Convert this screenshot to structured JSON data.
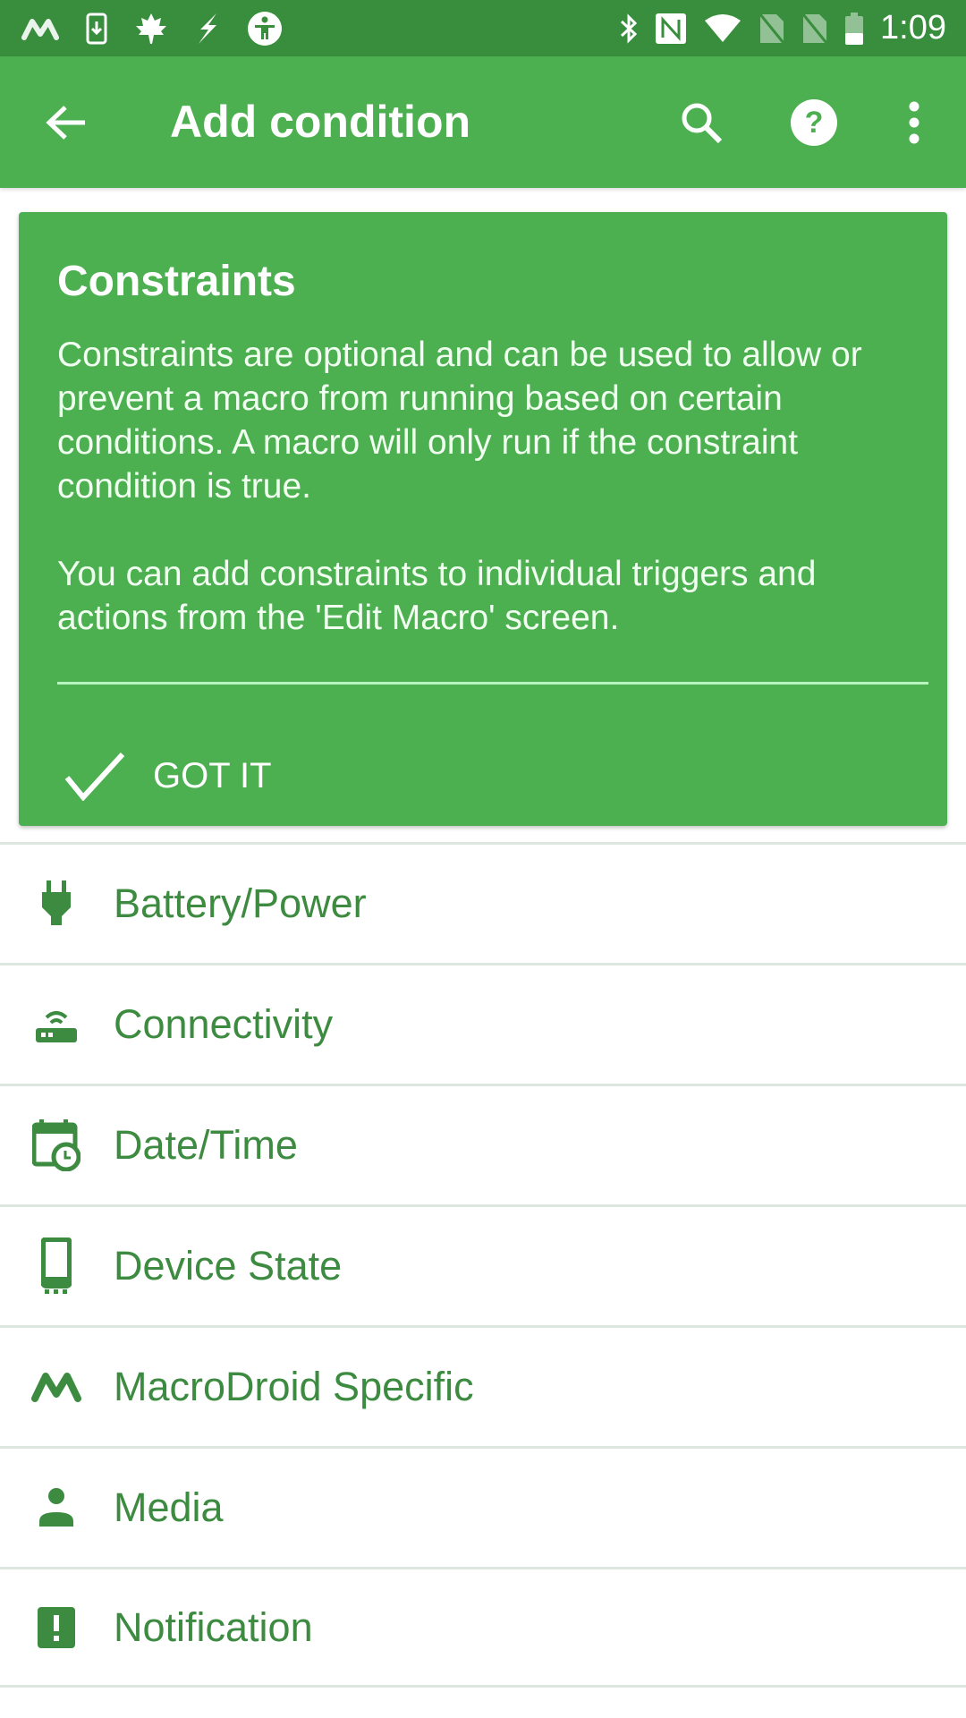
{
  "status_bar": {
    "left_icons": [
      "macrodroid-icon",
      "download-phone-icon",
      "maple-leaf-icon",
      "flash-icon",
      "accessibility-icon"
    ],
    "right_icons": [
      "bluetooth-icon",
      "nfc-icon",
      "wifi-icon",
      "no-sim-icon",
      "no-sim-icon",
      "battery-icon"
    ],
    "time": "1:09"
  },
  "app_bar": {
    "title": "Add condition",
    "back_icon": "arrow-back-icon",
    "actions": [
      "search-icon",
      "help-icon",
      "more-vert-icon"
    ]
  },
  "info_card": {
    "title": "Constraints",
    "paragraphs": [
      "Constraints are optional and can be used to allow or prevent a macro from running based on certain conditions. A macro will only run if the constraint condition is true.",
      "You can add constraints to individual triggers and actions from the 'Edit Macro' screen."
    ],
    "button_label": "GOT IT",
    "button_icon": "check-icon"
  },
  "categories": [
    {
      "label": "Battery/Power",
      "icon": "power-plug-icon"
    },
    {
      "label": "Connectivity",
      "icon": "router-icon"
    },
    {
      "label": "Date/Time",
      "icon": "calendar-clock-icon"
    },
    {
      "label": "Device State",
      "icon": "phone-icon"
    },
    {
      "label": "MacroDroid Specific",
      "icon": "macrodroid-icon"
    },
    {
      "label": "Media",
      "icon": "person-icon"
    },
    {
      "label": "Notification",
      "icon": "alert-box-icon"
    }
  ],
  "colors": {
    "status_bar": "#388e3c",
    "primary": "#4caf50",
    "list_text": "#3d8b40",
    "divider": "#dde6df"
  }
}
